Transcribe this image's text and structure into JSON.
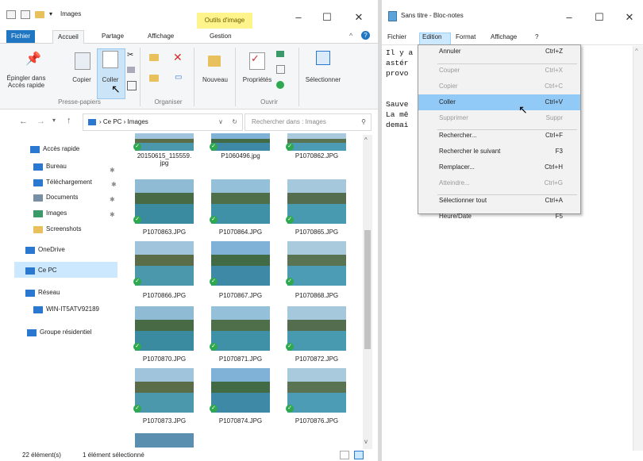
{
  "explorer": {
    "title": "Images",
    "contextual_tab": "Outils d'image",
    "tabs": [
      "Fichier",
      "Accueil",
      "Partage",
      "Affichage",
      "Gestion"
    ],
    "ribbon": {
      "pin_label": "Épingler dans\nAccès rapide",
      "copy_label": "Copier",
      "paste_label": "Coller",
      "new_label": "Nouveau",
      "properties_label": "Propriétés",
      "select_label": "Sélectionner",
      "groups": [
        "Presse-papiers",
        "Organiser",
        "Ouvrir"
      ]
    },
    "address": "› Ce PC › Images",
    "search_placeholder": "Rechercher dans : Images",
    "nav": [
      {
        "label": "Accès rapide",
        "icon": "star-icon",
        "color": "#2b78d0"
      },
      {
        "label": "Bureau",
        "icon": "desktop-icon",
        "color": "#2b78d0"
      },
      {
        "label": "Téléchargement",
        "icon": "download-icon",
        "color": "#2b78d0"
      },
      {
        "label": "Documents",
        "icon": "documents-icon",
        "color": "#7a8fa3"
      },
      {
        "label": "Images",
        "icon": "images-icon",
        "color": "#3a9a6a"
      },
      {
        "label": "Screenshots",
        "icon": "folder-icon",
        "color": "#e8c15c"
      },
      {
        "label": "OneDrive",
        "icon": "cloud-icon",
        "color": "#2b78d0"
      },
      {
        "label": "Ce PC",
        "icon": "computer-icon",
        "color": "#2b78d0"
      },
      {
        "label": "Réseau",
        "icon": "network-icon",
        "color": "#2b78d0"
      },
      {
        "label": "WIN-IT5ATV92189",
        "icon": "computer-icon",
        "color": "#2b78d0"
      },
      {
        "label": "Groupe résidentiel",
        "icon": "homegroup-icon",
        "color": "#2b78d0"
      }
    ],
    "files": [
      {
        "name": "20150615_115559.\njpg"
      },
      {
        "name": "P1060496.jpg"
      },
      {
        "name": "P1070862.JPG"
      },
      {
        "name": "P1070863.JPG"
      },
      {
        "name": "P1070864.JPG"
      },
      {
        "name": "P1070865.JPG"
      },
      {
        "name": "P1070866.JPG"
      },
      {
        "name": "P1070867.JPG"
      },
      {
        "name": "P1070868.JPG"
      },
      {
        "name": "P1070870.JPG"
      },
      {
        "name": "P1070871.JPG"
      },
      {
        "name": "P1070872.JPG"
      },
      {
        "name": "P1070873.JPG"
      },
      {
        "name": "P1070874.JPG"
      },
      {
        "name": "P1070876.JPG"
      }
    ],
    "status_count": "22 élément(s)",
    "status_selected": "1 élément sélectionné"
  },
  "notepad": {
    "title": "Sans titre - Bloc-notes",
    "menu": [
      "Fichier",
      "Edition",
      "Format",
      "Affichage",
      "?"
    ],
    "text_lines": [
      "Il y a               un énorme",
      "astér                , ce qui a",
      "provo               es.",
      "",
      "",
      "Sauve               e travail.",
      "La mê               roduire",
      "demai"
    ],
    "edit_menu": [
      {
        "label": "Annuler",
        "shortcut": "Ctrl+Z",
        "disabled": false
      },
      {
        "label": "Couper",
        "shortcut": "Ctrl+X",
        "disabled": true
      },
      {
        "label": "Copier",
        "shortcut": "Ctrl+C",
        "disabled": true
      },
      {
        "label": "Coller",
        "shortcut": "Ctrl+V",
        "disabled": false,
        "highlighted": true
      },
      {
        "label": "Supprimer",
        "shortcut": "Suppr",
        "disabled": true
      },
      {
        "label": "Rechercher...",
        "shortcut": "Ctrl+F",
        "disabled": false
      },
      {
        "label": "Rechercher le suivant",
        "shortcut": "F3",
        "disabled": false
      },
      {
        "label": "Remplacer...",
        "shortcut": "Ctrl+H",
        "disabled": false
      },
      {
        "label": "Atteindre...",
        "shortcut": "Ctrl+G",
        "disabled": true
      },
      {
        "label": "Sélectionner tout",
        "shortcut": "Ctrl+A",
        "disabled": false
      },
      {
        "label": "Heure/Date",
        "shortcut": "F5",
        "disabled": false
      }
    ]
  },
  "window_controls": {
    "minimize": "–",
    "maximize": "☐",
    "close": "✕"
  }
}
